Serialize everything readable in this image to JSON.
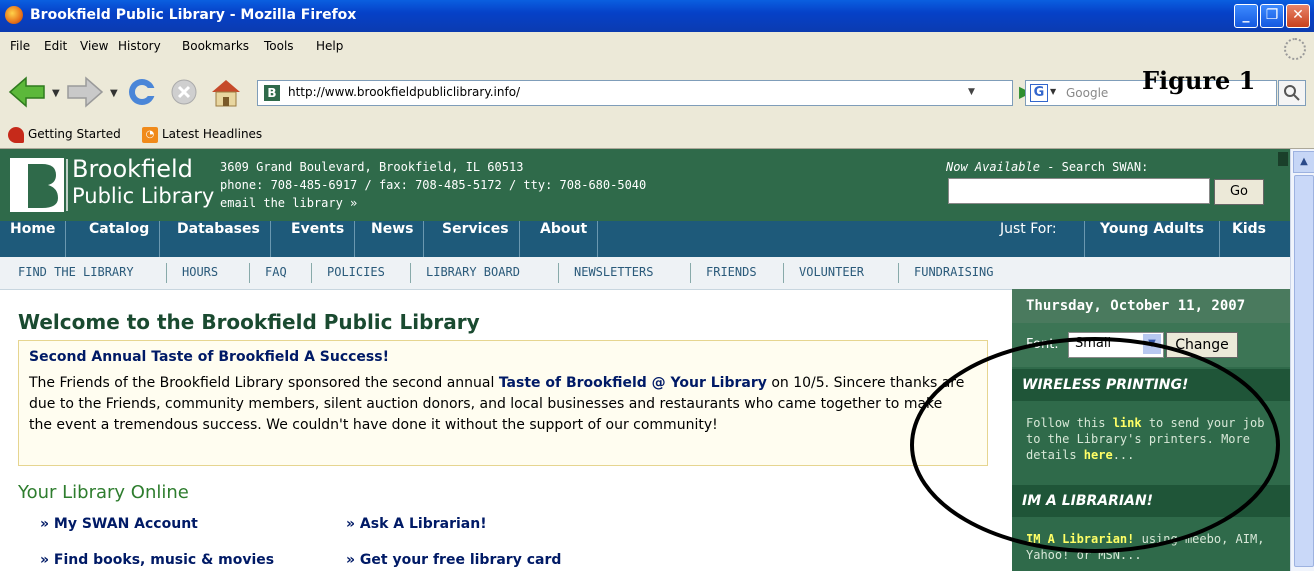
{
  "window": {
    "title": "Brookfield Public Library - Mozilla Firefox"
  },
  "menu": [
    "File",
    "Edit",
    "View",
    "History",
    "Bookmarks",
    "Tools",
    "Help"
  ],
  "address": {
    "url": "http://www.brookfieldpubliclibrary.info/"
  },
  "search": {
    "placeholder": "Google"
  },
  "bookmarks": [
    "Getting Started",
    "Latest Headlines"
  ],
  "annotation": {
    "figure_label": "Figure 1"
  },
  "header": {
    "logo_line1": "Brookfield",
    "logo_line2": "Public Library",
    "address": "3609 Grand Boulevard, Brookfield, IL 60513",
    "phone": "phone: 708-485-6917 / fax: 708-485-5172 / tty: 708-680-5040",
    "email": "email the library »",
    "now_available": "Now Available",
    "search_swan": " - Search SWAN:",
    "go_label": "Go"
  },
  "main_nav": [
    "Home",
    "Catalog",
    "Databases",
    "Events",
    "News",
    "Services",
    "About"
  ],
  "just_for": {
    "label": "Just For:",
    "items": [
      "Young Adults",
      "Kids"
    ]
  },
  "sub_nav": [
    "FIND THE LIBRARY",
    "HOURS",
    "FAQ",
    "POLICIES",
    "LIBRARY BOARD",
    "NEWSLETTERS",
    "FRIENDS",
    "VOLUNTEER",
    "FUNDRAISING"
  ],
  "content": {
    "welcome": "Welcome to the Brookfield Public Library",
    "news_headline": "Second Annual Taste of Brookfield A Success!",
    "news_p1": "The Friends of the Brookfield Library sponsored the second annual ",
    "news_link": "Taste of Brookfield @ Your Library",
    "news_p2": " on 10/5. Sincere thanks are due to the Friends, community members, silent auction donors, and local businesses and restaurants who came together to make the event a tremendous success. We couldn't have done it without the support of our community!",
    "online_title": "Your Library Online",
    "links": [
      "» My SWAN Account",
      "» Ask A Librarian!",
      "» Find books, music & movies",
      "» Get your free library card"
    ]
  },
  "sidebar": {
    "date": "Thursday, October 11, 2007",
    "font_label": "Font:",
    "font_value": "Small",
    "change_label": "Change",
    "wireless_heading": "WIRELESS PRINTING!",
    "wireless_t1": "Follow this ",
    "wireless_link": "link",
    "wireless_t2": " to send your job to the Library's printers. More details ",
    "wireless_here": "here",
    "wireless_t3": "...",
    "im_heading": "IM A LIBRARIAN!",
    "im_link": "IM A Librarian!",
    "im_text": " using meebo, AIM, Yahoo! or MSN..."
  }
}
